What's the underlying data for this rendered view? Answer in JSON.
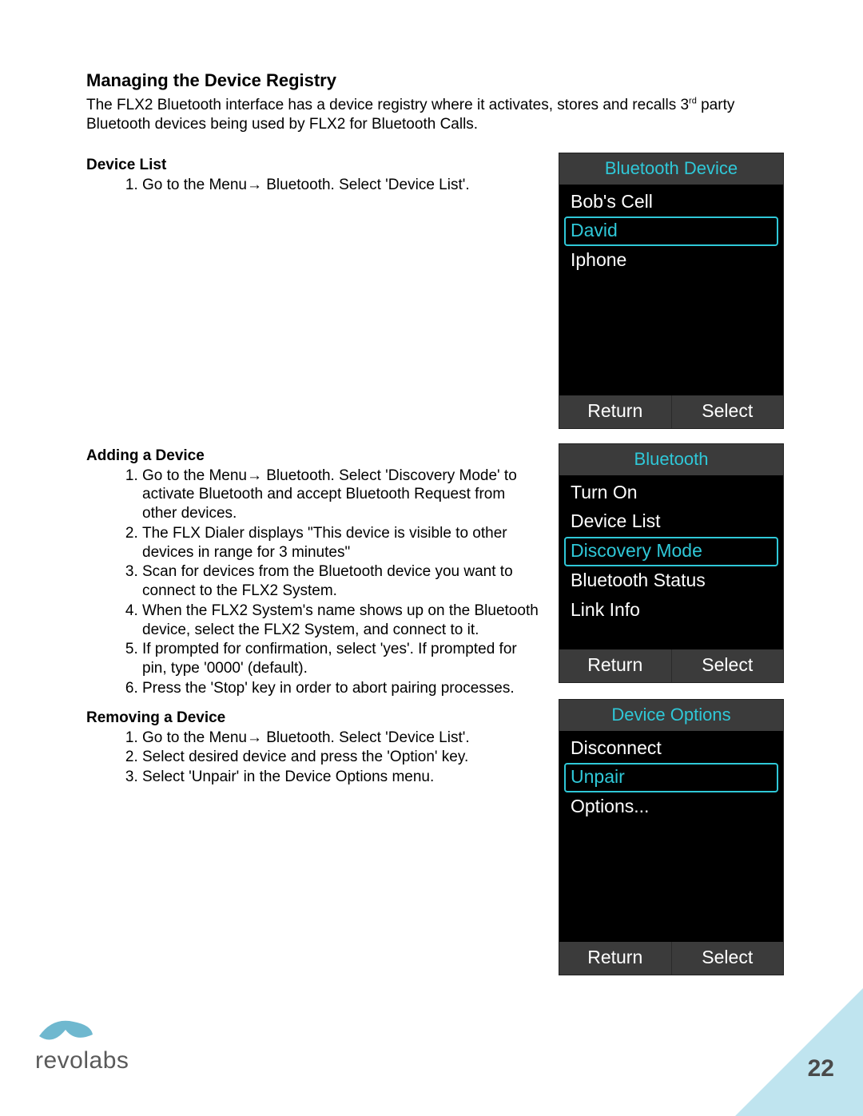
{
  "heading": "Managing the Device Registry",
  "intro_a": "The FLX2 Bluetooth interface has a device registry where it activates, stores and recalls 3",
  "intro_sup": "rd",
  "intro_b": " party Bluetooth devices being used by FLX2 for Bluetooth Calls.",
  "sections": {
    "device_list": {
      "title": "Device List",
      "items": [
        "Go to the Menu→ Bluetooth. Select 'Device List'."
      ]
    },
    "adding": {
      "title": "Adding a Device",
      "items": [
        "Go to the Menu→ Bluetooth. Select 'Discovery Mode' to activate Bluetooth and accept Bluetooth Request from other devices.",
        "The FLX Dialer displays \"This device is visible to other devices in range for 3 minutes\"",
        "Scan for devices from the Bluetooth device you want to connect to the FLX2 System.",
        "When the FLX2 System's name shows up on the Bluetooth device, select the FLX2 System, and connect to it.",
        "If prompted for confirmation, select 'yes'. If prompted for pin, type '0000' (default).",
        "Press the 'Stop' key in order to abort pairing processes."
      ]
    },
    "removing": {
      "title": "Removing a Device",
      "items": [
        "Go to the Menu→ Bluetooth. Select 'Device List'.",
        "Select desired device and press the 'Option' key.",
        "Select 'Unpair' in the Device Options menu."
      ]
    }
  },
  "screens": {
    "device_list": {
      "title": "Bluetooth Device",
      "items": [
        {
          "label": "Bob's Cell",
          "selected": false
        },
        {
          "label": "David",
          "selected": true
        },
        {
          "label": "Iphone",
          "selected": false
        }
      ],
      "soft_left": "Return",
      "soft_right": "Select"
    },
    "bluetooth_menu": {
      "title": "Bluetooth",
      "items": [
        {
          "label": "Turn On",
          "selected": false
        },
        {
          "label": "Device List",
          "selected": false
        },
        {
          "label": "Discovery Mode",
          "selected": true
        },
        {
          "label": "Bluetooth Status",
          "selected": false
        },
        {
          "label": "Link Info",
          "selected": false
        }
      ],
      "soft_left": "Return",
      "soft_right": "Select"
    },
    "device_options": {
      "title": "Device Options",
      "items": [
        {
          "label": "Disconnect",
          "selected": false
        },
        {
          "label": "Unpair",
          "selected": true
        },
        {
          "label": "Options...",
          "selected": false
        }
      ],
      "soft_left": "Return",
      "soft_right": "Select"
    }
  },
  "logo_text": "revolabs",
  "page_number": "22"
}
